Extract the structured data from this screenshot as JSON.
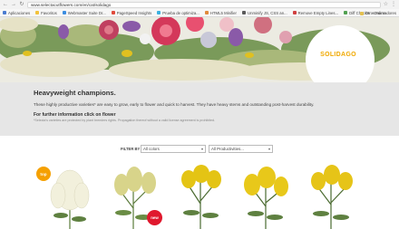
{
  "browser": {
    "url": "www.selectacutflowers.com/en/cat/solidago",
    "nav_icons": [
      "back-icon",
      "forward-icon",
      "reload-icon"
    ],
    "toolbar_icons": [
      "star-icon",
      "menu-icon"
    ]
  },
  "bookmarks": {
    "items": [
      {
        "label": "Aplicaciones",
        "color": "#4a7bd0"
      },
      {
        "label": "Favoritos",
        "color": "#f2c23b"
      },
      {
        "label": "Webmaster Suite Dr...",
        "color": "#3b8de0"
      },
      {
        "label": "PageSpeed Insights",
        "color": "#e04a3b"
      },
      {
        "label": "Prueba de optimiza...",
        "color": "#3bb0e0"
      },
      {
        "label": "HTML5 Minifier",
        "color": "#e08a3b"
      },
      {
        "label": "Unminify JS, CSS an...",
        "color": "#5a5a5a"
      },
      {
        "label": "Remove Empty Lines...",
        "color": "#d04040"
      },
      {
        "label": "Diff Checker - Online",
        "color": "#50a050"
      }
    ],
    "other_label": "Otros marcadores"
  },
  "hero": {
    "badge_label": "SOLIDAGO"
  },
  "intro": {
    "title": "Heavyweight champions.",
    "body": "These highly productive varieties* are easy to grow, early to flower and quick to harvest. They have heavy stems and outstanding post-harvest durability.",
    "link": "For further information click on flower",
    "note": "*Selecta's varieties are protected by plant breeders rights. Propagation thereof without a valid license agreement is prohibited."
  },
  "filter": {
    "label": "FILTER BY",
    "colors_value": "All colors",
    "productivities_value": "All Productivities..."
  },
  "products": {
    "top_badge": "top",
    "new_badge": "new",
    "items": [
      {
        "name": "white-solidago",
        "color": "#f2f0dc"
      },
      {
        "name": "cream-solidago",
        "color": "#d8d48a"
      },
      {
        "name": "yellow-solidago-1",
        "color": "#e4c414"
      },
      {
        "name": "yellow-solidago-2",
        "color": "#e8c81a"
      },
      {
        "name": "yellow-solidago-3",
        "color": "#e6c418"
      }
    ]
  },
  "colors": {
    "accent_orange": "#f0a800",
    "badge_red": "#e0182d",
    "intro_bg": "#e6e6e6"
  }
}
